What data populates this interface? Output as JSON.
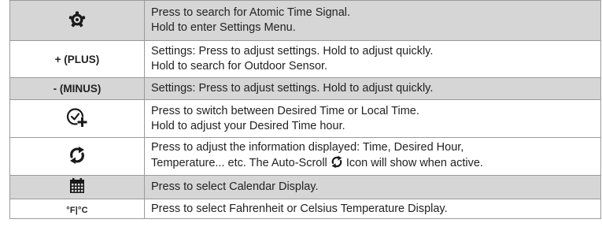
{
  "rows": [
    {
      "icon": "settings-gear-icon",
      "desc_lines": [
        "Press to search for Atomic Time Signal.",
        "Hold to enter Settings Menu."
      ]
    },
    {
      "button_label": "+ (PLUS)",
      "settings_prefix": "Settings:",
      "line1_rest": " Press to adjust settings. Hold to adjust quickly.",
      "line2": "Hold to search for Outdoor Sensor."
    },
    {
      "button_label": "- (MINUS)",
      "settings_prefix": "Settings:",
      "line1_rest": " Press to adjust settings. Hold to adjust quickly."
    },
    {
      "icon": "clock-plus-icon",
      "desc_lines": [
        "Press to switch between Desired Time or Local Time.",
        "Hold to adjust your Desired Time hour."
      ]
    },
    {
      "icon": "auto-scroll-icon",
      "line1": "Press to adjust the information displayed: Time, Desired Hour,",
      "line2_before": "Temperature... etc. The Auto-Scroll ",
      "line2_after": " Icon will show when active."
    },
    {
      "icon": "calendar-icon",
      "desc_lines": [
        "Press to select Calendar Display."
      ]
    },
    {
      "button_label": "°F|°C",
      "desc_lines": [
        "Press to select Fahrenheit or Celsius Temperature Display."
      ]
    }
  ],
  "colors": {
    "shaded_row": "#d6d6d6",
    "border": "#9a9a9a",
    "text": "#222222"
  }
}
